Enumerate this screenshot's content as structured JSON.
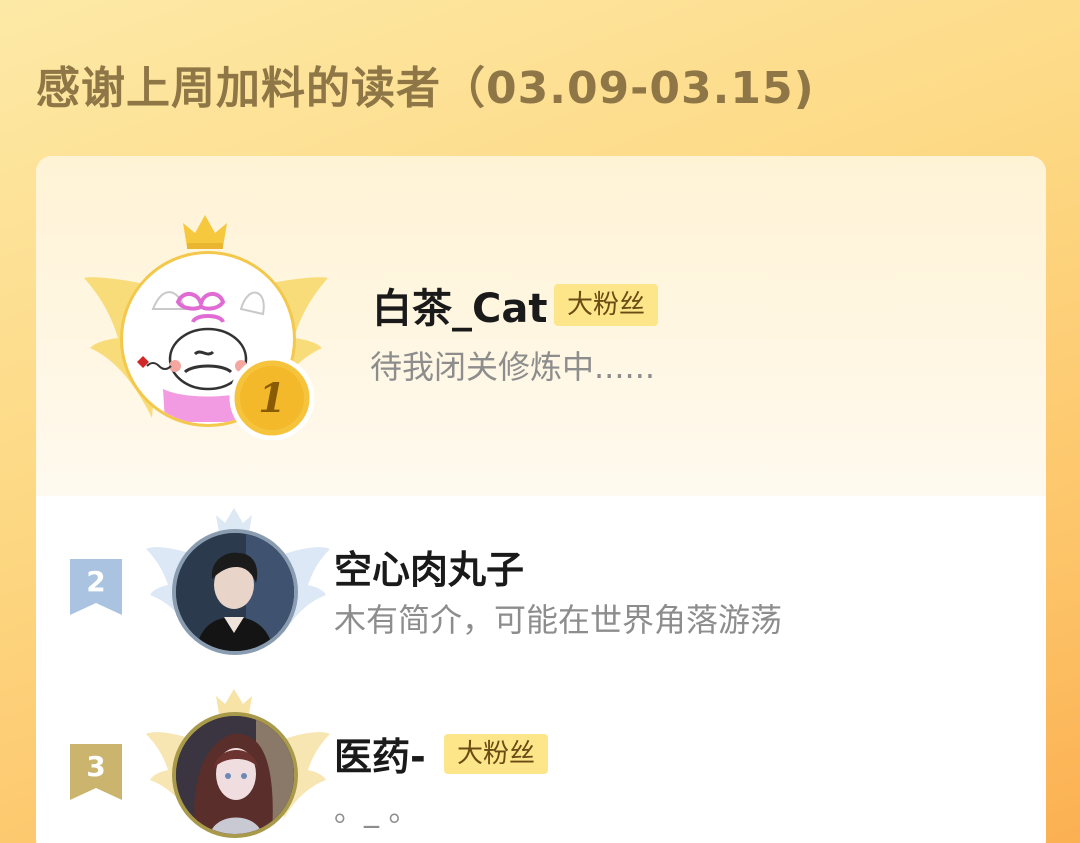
{
  "header": {
    "title": "感谢上周加料的读者（03.09-03.15)"
  },
  "readers": [
    {
      "rank": "1",
      "name": "白茶_Cat",
      "badge": "大粉丝",
      "bio": "待我闭关修炼中......"
    },
    {
      "rank": "2",
      "name": "空心肉丸子",
      "badge": "",
      "bio": "木有简介，可能在世界角落游荡"
    },
    {
      "rank": "3",
      "name": "医药-",
      "badge": "大粉丝",
      "bio": "。_ 。"
    }
  ],
  "colors": {
    "background_accent": "#fdc56a",
    "title": "#8e7646",
    "badge_bg": "#fde58a",
    "gold": "#f5c13a",
    "silver": "#a8c4e2",
    "bronze": "#c9b16a"
  }
}
